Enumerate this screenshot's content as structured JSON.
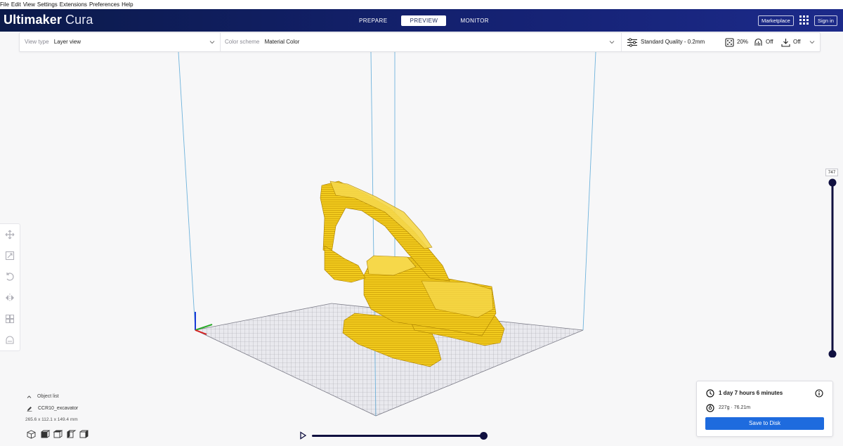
{
  "menu": [
    "File",
    "Edit",
    "View",
    "Settings",
    "Extensions",
    "Preferences",
    "Help"
  ],
  "header": {
    "brand": "Ultimaker",
    "product": "Cura",
    "tabs": [
      {
        "label": "PREPARE",
        "active": false
      },
      {
        "label": "PREVIEW",
        "active": true
      },
      {
        "label": "MONITOR",
        "active": false
      }
    ],
    "marketplace": "Marketplace",
    "sign_in": "Sign in"
  },
  "toolbar": {
    "view_type_label": "View type",
    "view_type_value": "Layer view",
    "color_scheme_label": "Color scheme",
    "color_scheme_value": "Material Color",
    "profile": "Standard Quality - 0.2mm",
    "infill": "20%",
    "support": "Off",
    "adhesion": "Off"
  },
  "layer_slider": {
    "current_layer": "747"
  },
  "object_list": {
    "header": "Object list",
    "object_name": "CCR10_excavator",
    "dimensions": "265.6 x 112.1 x 149.4 mm"
  },
  "output": {
    "print_time": "1 day 7 hours 6 minutes",
    "material": "227g · 76.21m",
    "save_button": "Save to Disk"
  },
  "colors": {
    "header_bg": "#142170",
    "accent_blue": "#1e6bde",
    "model_yellow": "#f2cb1d",
    "build_volume_line": "#6fb3dc"
  }
}
